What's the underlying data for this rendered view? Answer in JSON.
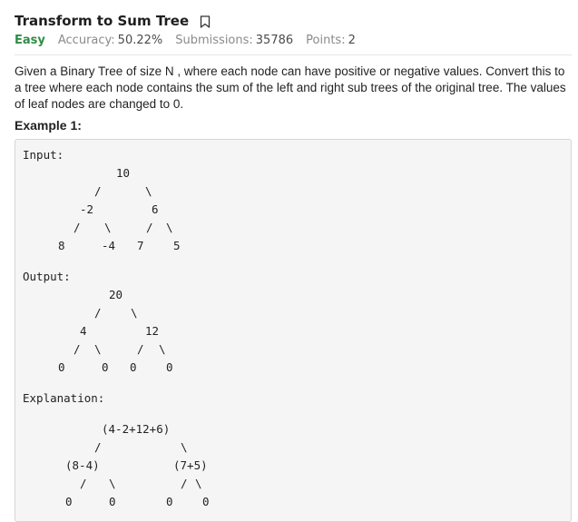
{
  "problem": {
    "title": "Transform to Sum Tree",
    "difficulty": "Easy",
    "accuracy_label": "Accuracy:",
    "accuracy_value": "50.22%",
    "submissions_label": "Submissions:",
    "submissions_value": "35786",
    "points_label": "Points:",
    "points_value": "2"
  },
  "description": "Given a Binary Tree of size N , where each node can have positive or negative values. Convert this to a tree where each node contains the sum of the left and right sub trees of the original tree. The values of leaf nodes are changed to 0.",
  "example": {
    "title": "Example 1:",
    "input_label": "Input:",
    "output_label": "Output:",
    "explanation_label": "Explanation:",
    "input_tree": {
      "root": "10",
      "l": "-2",
      "r": "6",
      "ll": "8",
      "lr": "-4",
      "rl": "7",
      "rr": "5",
      "slash": "/",
      "bslash": "\\"
    },
    "output_tree": {
      "root": "20",
      "l": "4",
      "r": "12",
      "ll": "0",
      "lr": "0",
      "rl": "0",
      "rr": "0"
    },
    "explanation_tree": {
      "root": "(4-2+12+6)",
      "l": "(8-4)",
      "r": "(7+5)",
      "ll": "0",
      "lr": "0",
      "rl": "0",
      "rr": "0"
    }
  }
}
